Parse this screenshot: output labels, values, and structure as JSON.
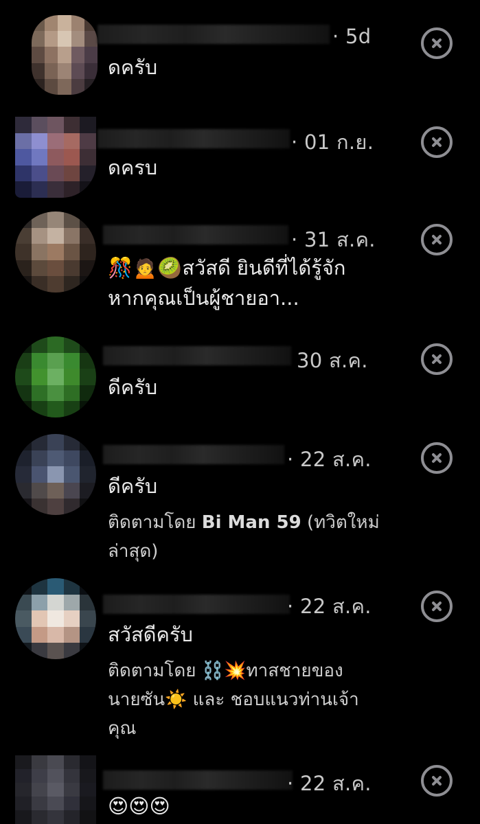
{
  "notifications": [
    {
      "time": "· 5d",
      "message": "ดครับ",
      "follow_prefix": "",
      "follow_name": "",
      "follow_suffix": ""
    },
    {
      "time": "· 01 ก.ย.",
      "message": "ดครบ",
      "follow_prefix": "",
      "follow_name": "",
      "follow_suffix": ""
    },
    {
      "time": "· 31 ส.ค.",
      "message": "🎊🙍🥝สวัสดี ยินดีที่ได้รู้จัก หากคุณเป็นผู้ชายอา...",
      "follow_prefix": "",
      "follow_name": "",
      "follow_suffix": ""
    },
    {
      "time": "30 ส.ค.",
      "message": "ดีครับ",
      "follow_prefix": "",
      "follow_name": "",
      "follow_suffix": ""
    },
    {
      "time": "· 22 ส.ค.",
      "message": "ดีครับ",
      "follow_prefix": "ติดตามโดย ",
      "follow_name": "Bi Man 59",
      "follow_suffix": " (ทวิตใหม่ล่าสุด)"
    },
    {
      "time": "· 22 ส.ค.",
      "message": "สวัสดีครับ",
      "follow_prefix": "ติดตามโดย ⛓️💥ทาสชายของนายซัน☀️ และ ชอบแนวท่านเจ้าคุณ",
      "follow_name": "",
      "follow_suffix": ""
    },
    {
      "time": "· 22 ส.ค.",
      "message": "😍😍😍",
      "follow_prefix": "",
      "follow_name": "",
      "follow_suffix": ""
    }
  ],
  "icons": {
    "dismiss": "close-circle-icon"
  },
  "colors": {
    "background": "#000000",
    "text_primary": "#eaeaea",
    "text_secondary": "#c8c8c8",
    "icon": "#8e8e93"
  }
}
